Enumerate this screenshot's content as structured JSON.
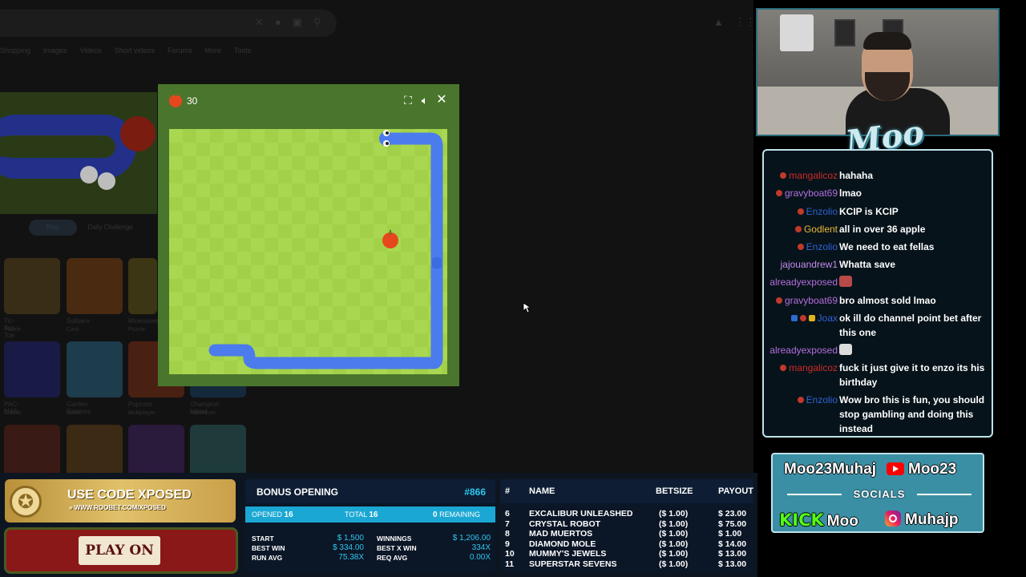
{
  "browser": {
    "tabs": [
      "Shopping",
      "Images",
      "Videos",
      "Short videos",
      "Forums",
      "More",
      "Tools"
    ],
    "pills": [
      "Play",
      "Daily Challenge"
    ],
    "tiles": [
      {
        "label": "Tic-Tac-Toe",
        "sub": "Puzzle",
        "color": "#3a2d16"
      },
      {
        "label": "Solitaire",
        "sub": "Card",
        "color": "#4a2a10"
      },
      {
        "label": "Minesweeper",
        "sub": "Puzzle",
        "color": "#3c3614"
      },
      {
        "label": "PAC-MAN",
        "sub": "Classic",
        "color": "#1a1a46"
      },
      {
        "label": "Garden Gnomes",
        "sub": "Action",
        "color": "#1d3c4c"
      },
      {
        "label": "Popcorn",
        "sub": "Multiplayer",
        "color": "#4a2012"
      },
      {
        "label": "Champion Island",
        "sub": "Adventure",
        "color": "#142a3c"
      },
      {
        "label": "",
        "sub": "",
        "color": "#3a1a14"
      },
      {
        "label": "",
        "sub": "",
        "color": "#3c2a14"
      },
      {
        "label": "",
        "sub": "",
        "color": "#2a1a3c"
      },
      {
        "label": "",
        "sub": "",
        "color": "#1e3a3a"
      }
    ]
  },
  "game": {
    "score": "30",
    "icons": [
      "fullscreen-icon",
      "volume-icon",
      "close-icon"
    ]
  },
  "webcam": {
    "logo": "Moo"
  },
  "chat": {
    "messages": [
      {
        "user": "mangalicoz",
        "color": "#cc2a2a",
        "badges": [
          "red"
        ],
        "text": "hahaha"
      },
      {
        "user": "gravyboat69",
        "color": "#b46ee0",
        "badges": [
          "red"
        ],
        "text": "lmao"
      },
      {
        "user": "Enzolio",
        "color": "#2e62d6",
        "badges": [
          "red"
        ],
        "text": "KCIP is KCIP"
      },
      {
        "user": "Godlent",
        "color": "#e8b83a",
        "badges": [
          "red"
        ],
        "text": "all in over 36 apple"
      },
      {
        "user": "Enzolio",
        "color": "#2e62d6",
        "badges": [
          "red"
        ],
        "text": "We need to eat fellas"
      },
      {
        "user": "jajouandrew1",
        "color": "#c58bea",
        "badges": [],
        "text": "Whatta save"
      },
      {
        "user": "alreadyexposed",
        "color": "#b46ee0",
        "badges": [],
        "text": "",
        "emote": "#b84a4a"
      },
      {
        "user": "gravyboat69",
        "color": "#b46ee0",
        "badges": [
          "red"
        ],
        "text": "bro almost sold lmao"
      },
      {
        "user": "Joax",
        "color": "#2e62d6",
        "badges": [
          "blue",
          "red",
          "gold"
        ],
        "text": "ok ill do channel point bet after this one"
      },
      {
        "user": "alreadyexposed",
        "color": "#b46ee0",
        "badges": [],
        "text": "",
        "emote": "#dcdcdc"
      },
      {
        "user": "mangalicoz",
        "color": "#cc2a2a",
        "badges": [
          "red"
        ],
        "text": "fuck it just give it to enzo its his birthday"
      },
      {
        "user": "Enzolio",
        "color": "#2e62d6",
        "badges": [
          "red"
        ],
        "text": "Wow bro this is fun, you should stop gambling and doing this instead"
      }
    ]
  },
  "socials": {
    "title": "SOCIALS",
    "kick_handle": "Moo23Muhaj",
    "youtube": "Moo23",
    "kick": "Moo",
    "kick_logo": "KICK",
    "instagram": "Muhajp"
  },
  "promo": {
    "title": "USE CODE XPOSED",
    "url": "» WWW.ROOBET.COM/XPOSED",
    "play_label": "PLAY ON"
  },
  "bonus": {
    "title": "BONUS OPENING",
    "id": "#866",
    "opened_label": "OPENED",
    "opened": "16",
    "total_label": "TOTAL",
    "total": "16",
    "remaining": "0",
    "remaining_label": "REMAINING",
    "start_label": "START",
    "start": "$ 1,500",
    "best_win_label": "BEST WIN",
    "best_win": "$ 334.00",
    "run_avg_label": "RUN AVG",
    "run_avg": "75.38X",
    "winnings_label": "WINNINGS",
    "winnings": "$ 1,206.00",
    "best_x_label": "BEST X WIN",
    "best_x": "334X",
    "req_avg_label": "REQ AVG",
    "req_avg": "0.00X"
  },
  "bets": {
    "headers": [
      "#",
      "NAME",
      "BETSIZE",
      "PAYOUT"
    ],
    "rows": [
      {
        "n": "6",
        "name": "EXCALIBUR UNLEASHED",
        "bet": "($ 1.00)",
        "payout": "$ 23.00"
      },
      {
        "n": "7",
        "name": "CRYSTAL ROBOT",
        "bet": "($ 1.00)",
        "payout": "$ 75.00"
      },
      {
        "n": "8",
        "name": "MAD MUERTOS",
        "bet": "($ 1.00)",
        "payout": "$ 1.00"
      },
      {
        "n": "9",
        "name": "DIAMOND MOLE",
        "bet": "($ 1.00)",
        "payout": "$ 14.00"
      },
      {
        "n": "10",
        "name": "MUMMY'S JEWELS",
        "bet": "($ 1.00)",
        "payout": "$ 13.00"
      },
      {
        "n": "11",
        "name": "SUPERSTAR SEVENS",
        "bet": "($ 1.00)",
        "payout": "$ 13.00"
      }
    ]
  }
}
